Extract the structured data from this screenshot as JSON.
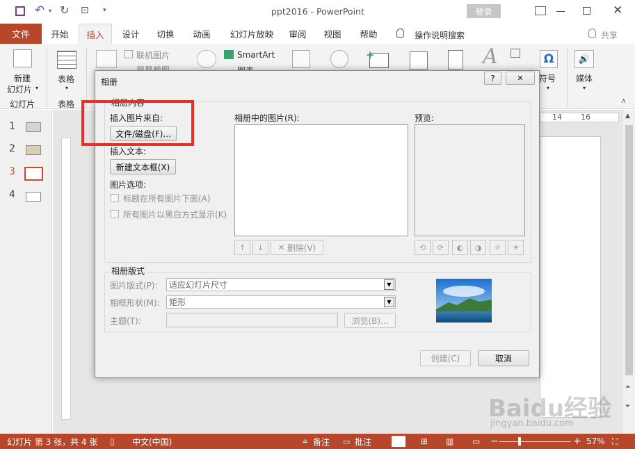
{
  "window": {
    "title": "ppt2016 - PowerPoint",
    "login_label": "登录",
    "share_label": "共享",
    "search_label": "操作说明搜索"
  },
  "tabs": [
    {
      "label": "文件"
    },
    {
      "label": "开始"
    },
    {
      "label": "插入"
    },
    {
      "label": "设计"
    },
    {
      "label": "切换"
    },
    {
      "label": "动画"
    },
    {
      "label": "幻灯片放映"
    },
    {
      "label": "审阅"
    },
    {
      "label": "视图"
    },
    {
      "label": "帮助"
    }
  ],
  "ribbon": {
    "new_slide": "新建",
    "new_slide2": "幻灯片",
    "slides_group": "幻灯片",
    "table": "表格",
    "table_group": "表格",
    "online_pic": "联机图片",
    "screenshot": "屏幕截图",
    "smartart": "SmartArt",
    "chart": "图表",
    "symbol": "符号",
    "media": "媒体"
  },
  "slides": [
    {
      "num": "1"
    },
    {
      "num": "2"
    },
    {
      "num": "3"
    },
    {
      "num": "4"
    }
  ],
  "ruler": {
    "h14": "14",
    "h16": "16"
  },
  "dialog": {
    "title": "相册",
    "help": "?",
    "close": "✕",
    "content_group": "相册内容",
    "insert_from": "插入图片来自:",
    "file_disk_btn": "文件/磁盘(F)...",
    "insert_text": "插入文本:",
    "new_textbox_btn": "新建文本框(X)",
    "pic_options": "图片选项:",
    "opt1": "标题在所有图片下面(A)",
    "opt2": "所有图片以黑白方式显示(K)",
    "pics_in_album": "相册中的图片(R):",
    "preview": "预览:",
    "delete_btn": "删除(V)",
    "layout_group": "相册版式",
    "pic_layout_label": "图片版式(P):",
    "pic_layout_value": "适应幻灯片尺寸",
    "frame_label": "相框形状(M):",
    "frame_value": "矩形",
    "theme_label": "主题(T):",
    "theme_value": "",
    "browse_btn": "浏览(B)...",
    "create_btn": "创建(C)",
    "cancel_btn": "取消"
  },
  "status": {
    "slide_info": "幻灯片 第 3 张，共 4 张",
    "lang": "中文(中国)",
    "notes": "备注",
    "comments": "批注",
    "zoom": "57%"
  },
  "watermark": {
    "brand": "Baidu经验",
    "url": "jingyan.baidu.com"
  },
  "colors": {
    "accent": "#b7472a",
    "highlight_box": "#e8302a"
  }
}
